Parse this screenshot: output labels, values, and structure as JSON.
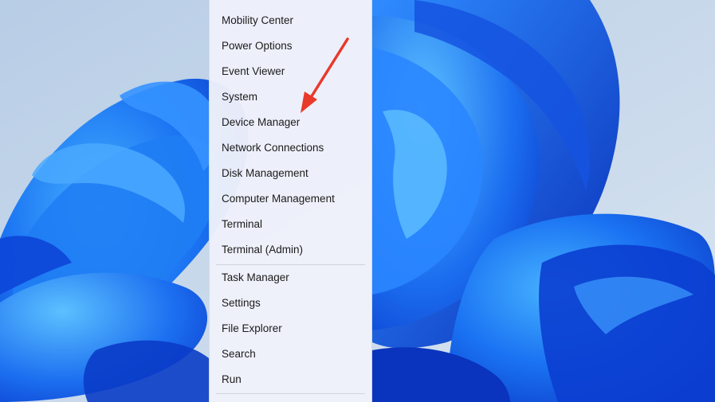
{
  "colors": {
    "sky": "#c9d8e8",
    "petal_dark": "#0b3fd1",
    "petal_mid": "#1a6cf0",
    "petal_light": "#3ea6ff",
    "menu_bg": "#eef1fa",
    "arrow": "#e8392b"
  },
  "context_menu": {
    "items": [
      {
        "id": "mobility-center",
        "label": "Mobility Center"
      },
      {
        "id": "power-options",
        "label": "Power Options"
      },
      {
        "id": "event-viewer",
        "label": "Event Viewer"
      },
      {
        "id": "system",
        "label": "System"
      },
      {
        "id": "device-manager",
        "label": "Device Manager"
      },
      {
        "id": "network-connections",
        "label": "Network Connections"
      },
      {
        "id": "disk-management",
        "label": "Disk Management"
      },
      {
        "id": "computer-management",
        "label": "Computer Management"
      },
      {
        "id": "terminal",
        "label": "Terminal"
      },
      {
        "id": "terminal-admin",
        "label": "Terminal (Admin)"
      },
      {
        "id": "task-manager",
        "label": "Task Manager"
      },
      {
        "id": "settings",
        "label": "Settings"
      },
      {
        "id": "file-explorer",
        "label": "File Explorer"
      },
      {
        "id": "search",
        "label": "Search"
      },
      {
        "id": "run",
        "label": "Run"
      }
    ]
  },
  "annotation": {
    "icon": "red-arrow-icon",
    "points_to": "Device Manager"
  }
}
